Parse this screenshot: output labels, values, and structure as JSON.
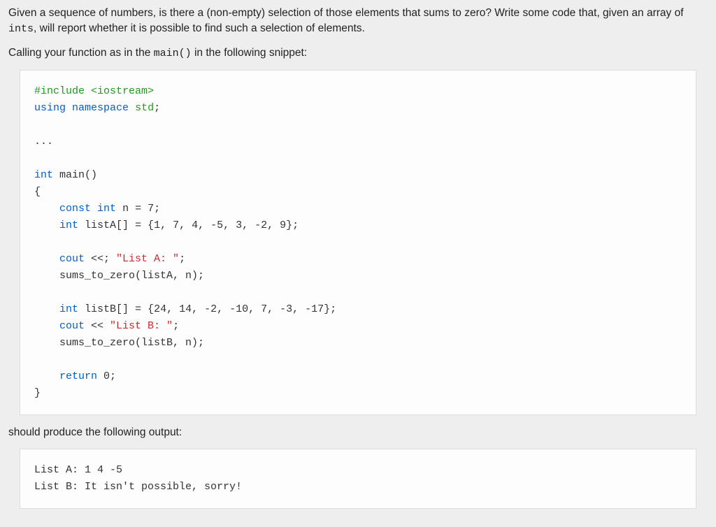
{
  "intro": {
    "p1_a": "Given a sequence of numbers, is there a (non-empty) selection of those elements that sums to zero? Write some code that, given an array of ",
    "p1_code": "ints",
    "p1_b": ", will report whether it is possible to find such a selection of elements.",
    "p2_a": "Calling your function as in the ",
    "p2_code": "main()",
    "p2_b": " in the following snippet:"
  },
  "code": {
    "include_pre": "#include ",
    "include_hdr": "<iostream>",
    "using": "using",
    "namespace": "namespace",
    "std": "std",
    "semicolon": ";",
    "ellipsis": "...",
    "int": "int",
    "main": "main",
    "parens": "()",
    "lbrace": "{",
    "rbrace": "}",
    "const": "const",
    "n_decl": " n = ",
    "n_val": "7",
    "listA_decl": " listA[] = {",
    "listA_vals": "1, 7, 4, -5, 3, -2, 9",
    "close_brace_semi": "};",
    "cout": "cout",
    "ins_err": " <<; ",
    "ins": " << ",
    "strA": "\"List A: \"",
    "sums": "sums_to_zero",
    "callA": "(listA, n);",
    "listB_decl": " listB[] = {",
    "listB_vals": "24, 14, -2, -10, 7, -3, -17",
    "strB": "\"List B: \"",
    "callB": "(listB, n);",
    "return": "return",
    "zero": " 0;"
  },
  "mid": {
    "p": "should produce the following output:"
  },
  "output": {
    "line1": "List A: 1 4 -5",
    "line2": "List B: It isn't possible, sorry!"
  }
}
